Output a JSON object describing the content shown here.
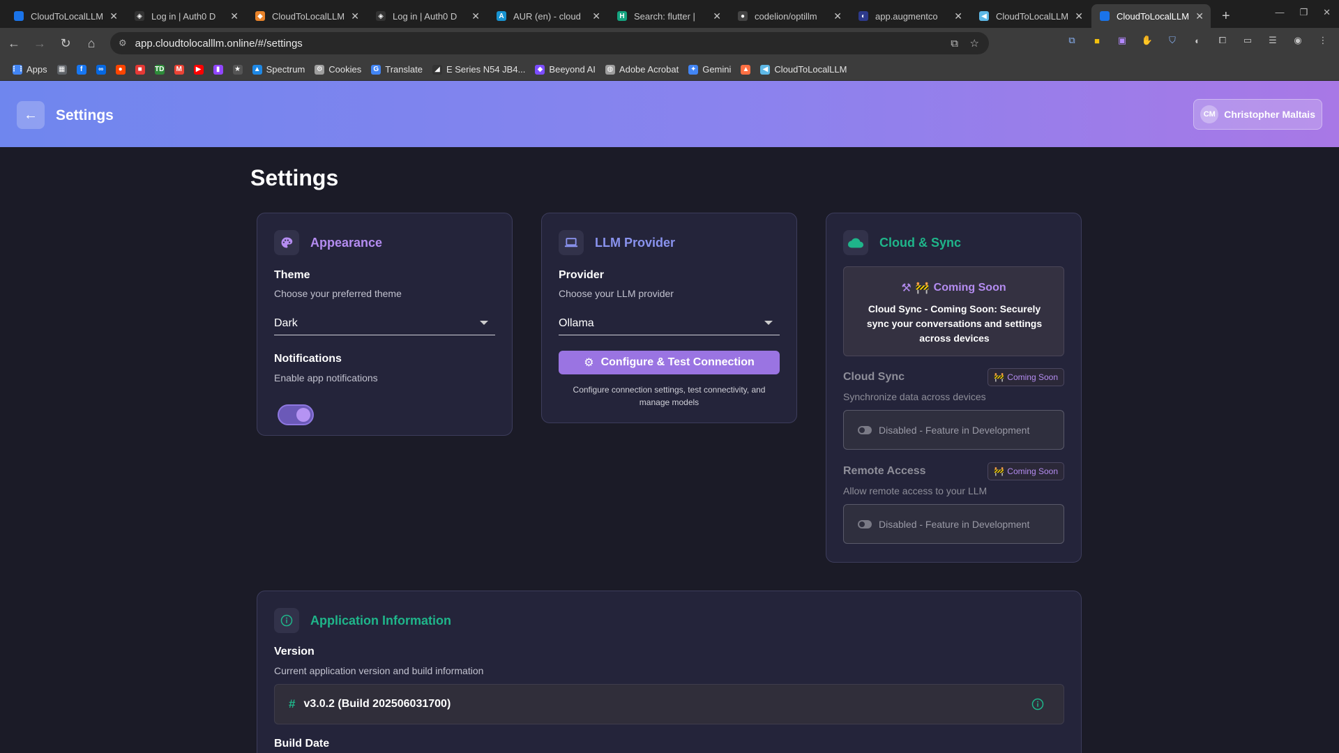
{
  "browser": {
    "tabs": [
      {
        "title": "CloudToLocalLLM",
        "color": "#1a73e8",
        "glyph": "",
        "active": false
      },
      {
        "title": "Log in | Auth0 D",
        "color": "#333333",
        "glyph": "◈",
        "active": false
      },
      {
        "title": "CloudToLocalLLM",
        "color": "#e8832a",
        "glyph": "◆",
        "active": false
      },
      {
        "title": "Log in | Auth0 D",
        "color": "#333333",
        "glyph": "◈",
        "active": false
      },
      {
        "title": "AUR (en) - cloud",
        "color": "#1793d1",
        "glyph": "A",
        "active": false
      },
      {
        "title": "Search: flutter |",
        "color": "#14a37f",
        "glyph": "H",
        "active": false
      },
      {
        "title": "codelion/optillm",
        "color": "#444444",
        "glyph": "●",
        "active": false
      },
      {
        "title": "app.augmentco",
        "color": "#2d3a8c",
        "glyph": "◐",
        "active": false
      },
      {
        "title": "CloudToLocalLLM",
        "color": "#5eb8e6",
        "glyph": "◀",
        "active": false
      },
      {
        "title": "CloudToLocalLLM",
        "color": "#1a73e8",
        "glyph": "",
        "active": true
      }
    ],
    "new_tab_label": "+",
    "url": "app.cloudtolocalllm.online/#/settings",
    "bookmarks": [
      {
        "label": "Apps",
        "icon": "apps-grid-icon",
        "color": "#4285f4"
      },
      {
        "label": "",
        "icon": "grid-icon",
        "color": "#5f6368"
      },
      {
        "label": "",
        "icon": "facebook-icon",
        "color": "#1877f2"
      },
      {
        "label": "",
        "icon": "meta-icon",
        "color": "#0668e1"
      },
      {
        "label": "",
        "icon": "reddit-icon",
        "color": "#ff4500"
      },
      {
        "label": "",
        "icon": "flag-icon",
        "color": "#e53935"
      },
      {
        "label": "",
        "icon": "td-icon",
        "color": "#2e8b3a"
      },
      {
        "label": "",
        "icon": "gmail-icon",
        "color": "#ea4335"
      },
      {
        "label": "",
        "icon": "youtube-icon",
        "color": "#ff0000"
      },
      {
        "label": "",
        "icon": "twitch-icon",
        "color": "#9146ff"
      },
      {
        "label": "",
        "icon": "rating-icon",
        "color": "#555555"
      },
      {
        "label": "Spectrum",
        "icon": "spectrum-icon",
        "color": "#1e88e5"
      },
      {
        "label": "Cookies",
        "icon": "gear-icon",
        "color": "#9e9e9e"
      },
      {
        "label": "Translate",
        "icon": "translate-icon",
        "color": "#4285f4"
      },
      {
        "label": "E Series N54 JB4...",
        "icon": "car-icon",
        "color": "#333333"
      },
      {
        "label": "Beeyond AI",
        "icon": "beeyond-icon",
        "color": "#7c4dff"
      },
      {
        "label": "Adobe Acrobat",
        "icon": "globe-icon",
        "color": "#9e9e9e"
      },
      {
        "label": "Gemini",
        "icon": "gemini-icon",
        "color": "#4285f4"
      },
      {
        "label": "",
        "icon": "flame-icon",
        "color": "#ff7043"
      },
      {
        "label": "CloudToLocalLLM",
        "icon": "flutter-icon",
        "color": "#5eb8e6"
      }
    ]
  },
  "header": {
    "title": "Settings",
    "user_initials": "CM",
    "user_name": "Christopher Maltais"
  },
  "page_title": "Settings",
  "appearance": {
    "title": "Appearance",
    "accent": "#b48cf0",
    "theme_label": "Theme",
    "theme_desc": "Choose your preferred theme",
    "theme_value": "Dark",
    "notifications_label": "Notifications",
    "notifications_desc": "Enable app notifications",
    "notifications_enabled": true
  },
  "llm": {
    "title": "LLM Provider",
    "accent": "#8a93ee",
    "provider_label": "Provider",
    "provider_desc": "Choose your LLM provider",
    "provider_value": "Ollama",
    "configure_button": "Configure & Test Connection",
    "configure_note": "Configure connection settings, test connectivity, and manage models"
  },
  "cloud": {
    "title": "Cloud & Sync",
    "accent": "#1fb58a",
    "coming_soon_title": "Coming Soon",
    "coming_soon_text": "Cloud Sync - Coming Soon: Securely sync your conversations and settings across devices",
    "sync_label": "Cloud Sync",
    "sync_desc": "Synchronize data across devices",
    "sync_badge": "Coming Soon",
    "sync_status": "Disabled - Feature in Development",
    "remote_label": "Remote Access",
    "remote_desc": "Allow remote access to your LLM",
    "remote_badge": "Coming Soon",
    "remote_status": "Disabled - Feature in Development"
  },
  "app_info": {
    "title": "Application Information",
    "accent": "#1fb58a",
    "version_label": "Version",
    "version_desc": "Current application version and build information",
    "version_value": "v3.0.2 (Build 202506031700)",
    "build_date_label": "Build Date"
  }
}
